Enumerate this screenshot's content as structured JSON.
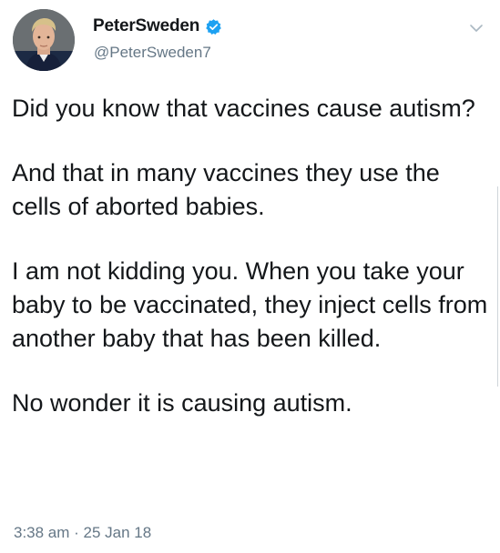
{
  "author": {
    "display_name": "PeterSweden",
    "handle": "@PeterSweden7",
    "verified_icon": "verified-badge-icon",
    "avatar_icon": "profile-avatar"
  },
  "tweet": {
    "paragraphs": [
      "Did you know that vaccines cause autism?",
      "And that in many vaccines they use the cells of aborted babies.",
      "I am not kidding you. When you take your baby to be vaccinated, they inject cells from another baby that has been killed.",
      "No wonder it is causing autism."
    ],
    "timestamp": "3:38 am · 25 Jan 18"
  },
  "menu": {
    "icon": "chevron-down-icon"
  },
  "colors": {
    "text": "#14171a",
    "secondary": "#657786",
    "verified": "#1da1f2"
  }
}
